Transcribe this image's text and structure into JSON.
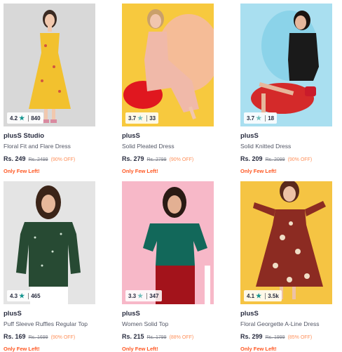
{
  "products": [
    {
      "brand": "plusS Studio",
      "name": "Floral Fit and Flare Dress",
      "price": "Rs. 249",
      "mrp": "Rs. 2499",
      "discount": "(90% OFF)",
      "stock": "Only Few Left!",
      "rating": "4.2",
      "count": "840",
      "star_color": "#14958f",
      "bg": "#d9d9d9",
      "dress": "#f2c12e"
    },
    {
      "brand": "plusS",
      "name": "Solid Pleated Dress",
      "price": "Rs. 279",
      "mrp": "Rs. 2799",
      "discount": "(90% OFF)",
      "stock": "Only Few Left!",
      "rating": "3.7",
      "count": "33",
      "star_color": "#72bfbc",
      "bg": "#f7c93e",
      "dress": "#f0b9a9"
    },
    {
      "brand": "plusS",
      "name": "Solid Knitted Dress",
      "price": "Rs. 209",
      "mrp": "Rs. 2099",
      "discount": "(90% OFF)",
      "stock": "Only Few Left!",
      "rating": "3.7",
      "count": "18",
      "star_color": "#72bfbc",
      "bg": "#a9dff0",
      "dress": "#1a1a1a"
    },
    {
      "brand": "plusS",
      "name": "Puff Sleeve Ruffles Regular Top",
      "price": "Rs. 169",
      "mrp": "Rs. 1699",
      "discount": "(90% OFF)",
      "stock": "Only Few Left!",
      "rating": "4.3",
      "count": "465",
      "star_color": "#14958f",
      "bg": "#e6e6e6",
      "dress": "#274a33"
    },
    {
      "brand": "plusS",
      "name": "Women Solid Top",
      "price": "Rs. 215",
      "mrp": "Rs. 1799",
      "discount": "(88% OFF)",
      "stock": "Only Few Left!",
      "rating": "3.3",
      "count": "347",
      "star_color": "#72bfbc",
      "bg": "#f7b8c8",
      "dress": "#12685a"
    },
    {
      "brand": "plusS",
      "name": "Floral Georgette A-Line Dress",
      "price": "Rs. 299",
      "mrp": "Rs. 1999",
      "discount": "(85% OFF)",
      "stock": "Only Few Left!",
      "rating": "4.1",
      "count": "3.5k",
      "star_color": "#14958f",
      "bg": "#f5c443",
      "dress": "#8c2b22"
    }
  ],
  "icons": {
    "rating": "star-icon"
  }
}
